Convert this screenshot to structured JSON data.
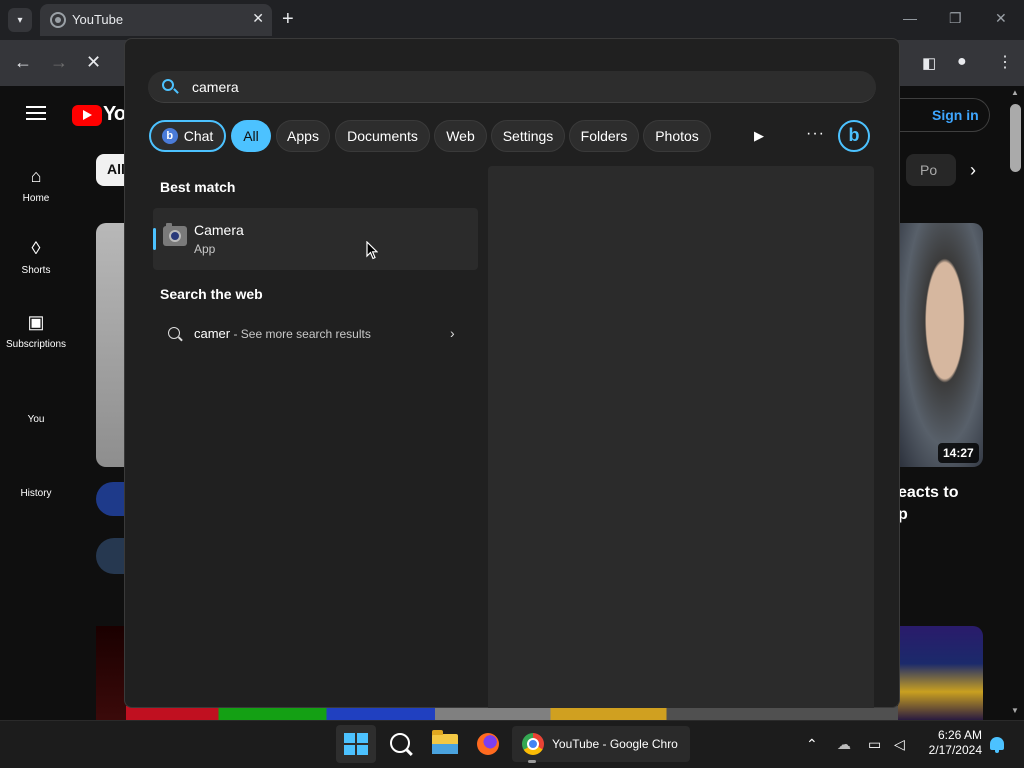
{
  "browser": {
    "tab_title": "YouTube",
    "new_tab": "+",
    "tab_close": "✕"
  },
  "youtube": {
    "logo_text": "You",
    "sidebar": [
      {
        "label": "Home",
        "icon": "home-icon"
      },
      {
        "label": "Shorts",
        "icon": "shorts-icon"
      },
      {
        "label": "Subscriptions",
        "icon": "subscriptions-icon"
      },
      {
        "label": "You",
        "icon": ""
      },
      {
        "label": "History",
        "icon": ""
      }
    ],
    "chip_all": "All",
    "chip_partial": "Po",
    "sign_in": "Sign in",
    "video_duration": "14:27",
    "video_title_fragment_1": "eacts to",
    "video_title_fragment_2": "p"
  },
  "search": {
    "query": "camera",
    "filters": [
      "Chat",
      "All",
      "Apps",
      "Documents",
      "Web",
      "Settings",
      "Folders",
      "Photos"
    ],
    "best_match_title": "Best match",
    "best_match": {
      "name": "Camera",
      "type": "App"
    },
    "web_section_title": "Search the web",
    "web_query": "camer",
    "web_more": " - See more search results",
    "more_dots": "···",
    "bing": "b"
  },
  "taskbar": {
    "chrome_label": "YouTube - Google Chro",
    "time": "6:26 AM",
    "date": "2/17/2024"
  },
  "colors": {
    "accent": "#4cc2ff",
    "youtube_red": "#ff0000",
    "link_blue": "#3ea6ff"
  }
}
